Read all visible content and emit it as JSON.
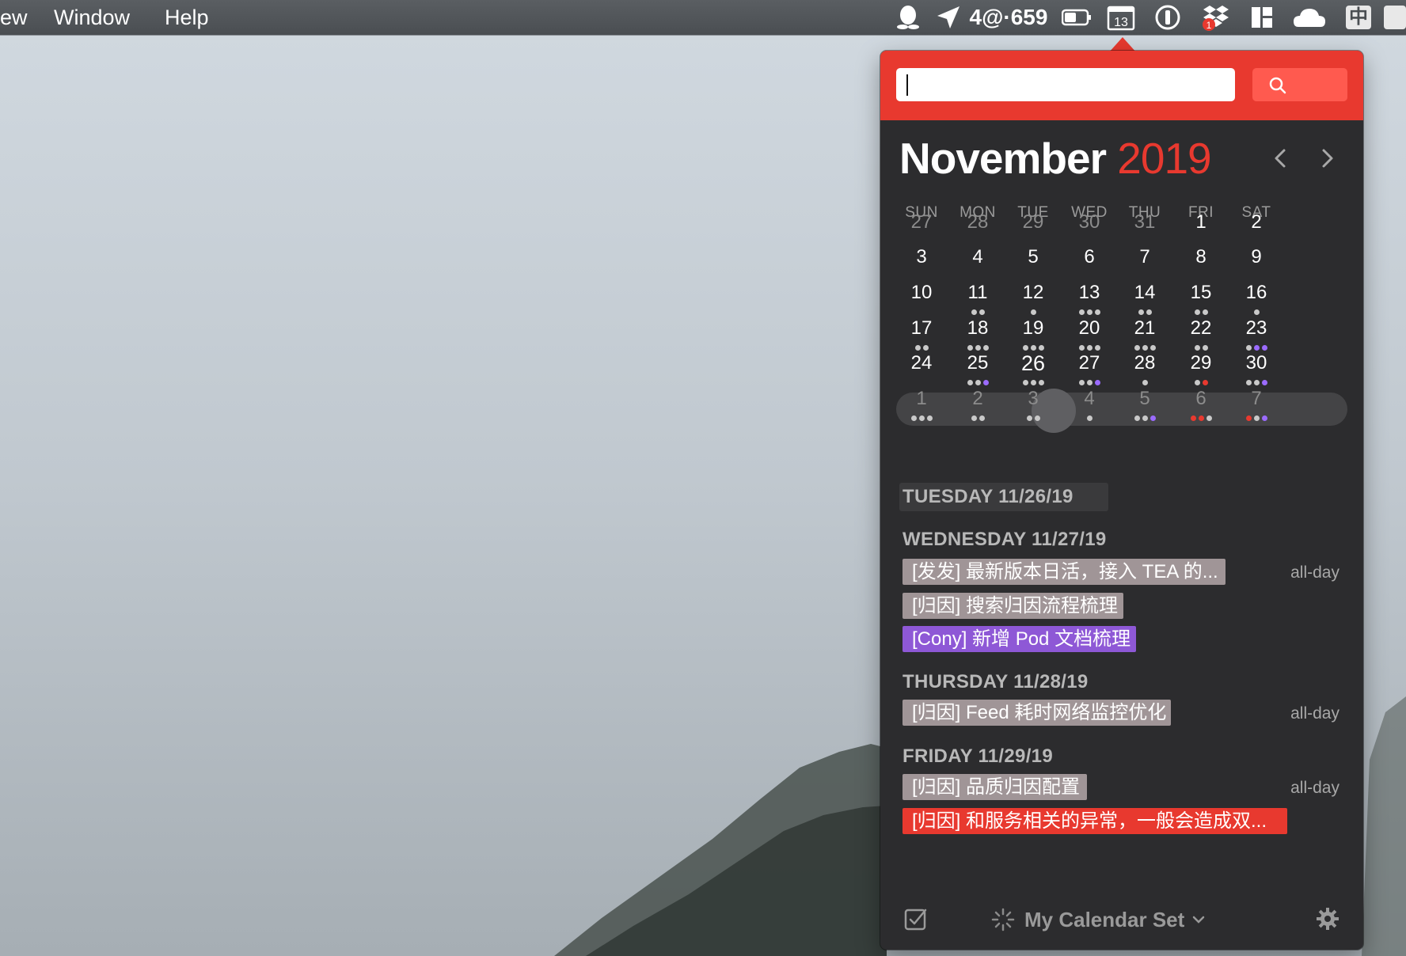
{
  "menubar": {
    "items": [
      "ew",
      "Window",
      "Help"
    ],
    "status_text": "4@·659",
    "calendar_icon_day": "13",
    "badge_count": "1",
    "input_method": "中"
  },
  "search": {
    "placeholder": ""
  },
  "calendar": {
    "month": "November",
    "year": "2019",
    "weekdays": [
      "SUN",
      "MON",
      "TUE",
      "WED",
      "THU",
      "FRI",
      "SAT"
    ],
    "weeks": [
      [
        {
          "d": "27",
          "o": true,
          "dots": []
        },
        {
          "d": "28",
          "o": true,
          "dots": []
        },
        {
          "d": "29",
          "o": true,
          "dots": []
        },
        {
          "d": "30",
          "o": true,
          "dots": []
        },
        {
          "d": "31",
          "o": true,
          "dots": []
        },
        {
          "d": "1",
          "dots": []
        },
        {
          "d": "2",
          "dots": []
        }
      ],
      [
        {
          "d": "3",
          "dots": []
        },
        {
          "d": "4",
          "dots": []
        },
        {
          "d": "5",
          "dots": []
        },
        {
          "d": "6",
          "dots": []
        },
        {
          "d": "7",
          "dots": []
        },
        {
          "d": "8",
          "dots": []
        },
        {
          "d": "9",
          "dots": []
        }
      ],
      [
        {
          "d": "10",
          "dots": []
        },
        {
          "d": "11",
          "dots": [
            "g",
            "g"
          ]
        },
        {
          "d": "12",
          "dots": [
            "g"
          ]
        },
        {
          "d": "13",
          "dots": [
            "g",
            "g",
            "g"
          ]
        },
        {
          "d": "14",
          "dots": [
            "g",
            "g"
          ]
        },
        {
          "d": "15",
          "dots": [
            "g",
            "g"
          ]
        },
        {
          "d": "16",
          "dots": [
            "g"
          ]
        }
      ],
      [
        {
          "d": "17",
          "dots": [
            "g",
            "g"
          ]
        },
        {
          "d": "18",
          "dots": [
            "g",
            "g",
            "g"
          ]
        },
        {
          "d": "19",
          "dots": [
            "g",
            "g",
            "g"
          ]
        },
        {
          "d": "20",
          "dots": [
            "g",
            "g",
            "g"
          ]
        },
        {
          "d": "21",
          "dots": [
            "g",
            "g",
            "g"
          ]
        },
        {
          "d": "22",
          "dots": [
            "g",
            "g"
          ]
        },
        {
          "d": "23",
          "dots": [
            "g",
            "p",
            "p"
          ]
        }
      ],
      [
        {
          "d": "24",
          "dots": []
        },
        {
          "d": "25",
          "dots": [
            "g",
            "g",
            "p"
          ]
        },
        {
          "d": "26",
          "today": true,
          "dots": [
            "g",
            "g",
            "g"
          ]
        },
        {
          "d": "27",
          "dots": [
            "g",
            "g",
            "p"
          ]
        },
        {
          "d": "28",
          "dots": [
            "g"
          ]
        },
        {
          "d": "29",
          "dots": [
            "g",
            "r"
          ]
        },
        {
          "d": "30",
          "dots": [
            "g",
            "g",
            "p"
          ]
        }
      ],
      [
        {
          "d": "1",
          "o": true,
          "dots": [
            "g",
            "g",
            "g"
          ]
        },
        {
          "d": "2",
          "o": true,
          "dots": [
            "g",
            "g"
          ]
        },
        {
          "d": "3",
          "o": true,
          "dots": [
            "g",
            "g"
          ]
        },
        {
          "d": "4",
          "o": true,
          "dots": [
            "g"
          ]
        },
        {
          "d": "5",
          "o": true,
          "dots": [
            "g",
            "g",
            "p"
          ]
        },
        {
          "d": "6",
          "o": true,
          "dots": [
            "r",
            "r",
            "g"
          ]
        },
        {
          "d": "7",
          "o": true,
          "dots": [
            "r",
            "g",
            "p"
          ]
        }
      ]
    ]
  },
  "agenda": {
    "tuesday": {
      "heading": "TUESDAY 11/26/19"
    },
    "wednesday": {
      "heading": "WEDNESDAY 11/27/19",
      "events": [
        {
          "title": "[发发] 最新版本日活，接入 TEA 的...",
          "time": "all-day"
        },
        {
          "title": "[归因] 搜索归因流程梳理",
          "time": ""
        },
        {
          "title": "[Cony] 新增 Pod 文档梳理",
          "time": ""
        }
      ]
    },
    "thursday": {
      "heading": "THURSDAY 11/28/19",
      "events": [
        {
          "title": "[归因] Feed 耗时网络监控优化",
          "time": "all-day"
        }
      ]
    },
    "friday": {
      "heading": "FRIDAY 11/29/19",
      "events": [
        {
          "title": "[归因] 品质归因配置",
          "time": "all-day"
        },
        {
          "title": "[归因] 和服务相关的异常，一般会造成双...",
          "time": ""
        }
      ]
    }
  },
  "footer": {
    "calendar_set": "My Calendar Set"
  },
  "colors": {
    "accent": "#e8392f",
    "purple": "#8e58d6",
    "gray_event": "#a09597",
    "panel": "#2c2c2e"
  },
  "icons": [
    "qq-icon",
    "location-arrow-icon",
    "battery-icon",
    "calendar-icon",
    "password-icon",
    "dropbox-icon",
    "layout-icon",
    "cloud-icon",
    "input-method-icon",
    "app-icon",
    "search-icon",
    "chevron-left-icon",
    "chevron-right-icon",
    "checkbox-icon",
    "spinner-icon",
    "chevron-down-icon",
    "gear-icon"
  ]
}
